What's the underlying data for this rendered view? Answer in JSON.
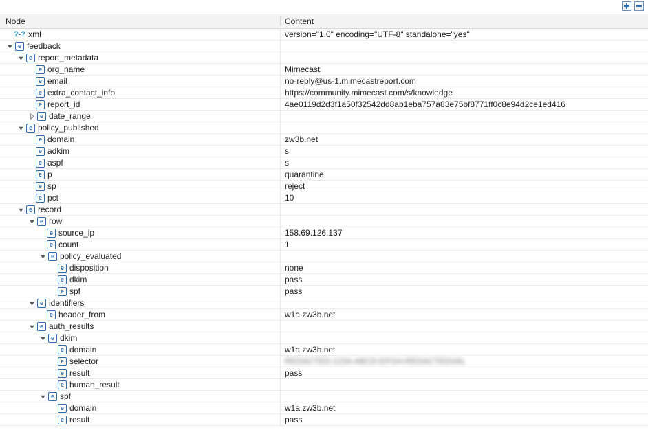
{
  "toolbar": {
    "expand_all": "Expand all",
    "collapse_all": "Collapse all"
  },
  "columns": {
    "node": "Node",
    "content": "Content"
  },
  "rows": [
    {
      "depth": 0,
      "toggle": "none",
      "icon": "pi",
      "label": "xml",
      "content": "version=\"1.0\" encoding=\"UTF-8\" standalone=\"yes\""
    },
    {
      "depth": 0,
      "toggle": "open",
      "icon": "e",
      "label": "feedback",
      "content": ""
    },
    {
      "depth": 1,
      "toggle": "open",
      "icon": "e",
      "label": "report_metadata",
      "content": ""
    },
    {
      "depth": 2,
      "toggle": "none",
      "icon": "e",
      "label": "org_name",
      "content": "Mimecast"
    },
    {
      "depth": 2,
      "toggle": "none",
      "icon": "e",
      "label": "email",
      "content": "no-reply@us-1.mimecastreport.com"
    },
    {
      "depth": 2,
      "toggle": "none",
      "icon": "e",
      "label": "extra_contact_info",
      "content": "https://community.mimecast.com/s/knowledge"
    },
    {
      "depth": 2,
      "toggle": "none",
      "icon": "e",
      "label": "report_id",
      "content": "4ae0119d2d3f1a50f32542dd8ab1eba757a83e75bf8771ff0c8e94d2ce1ed416"
    },
    {
      "depth": 2,
      "toggle": "closed",
      "icon": "e",
      "label": "date_range",
      "content": ""
    },
    {
      "depth": 1,
      "toggle": "open",
      "icon": "e",
      "label": "policy_published",
      "content": ""
    },
    {
      "depth": 2,
      "toggle": "none",
      "icon": "e",
      "label": "domain",
      "content": "zw3b.net"
    },
    {
      "depth": 2,
      "toggle": "none",
      "icon": "e",
      "label": "adkim",
      "content": "s"
    },
    {
      "depth": 2,
      "toggle": "none",
      "icon": "e",
      "label": "aspf",
      "content": "s"
    },
    {
      "depth": 2,
      "toggle": "none",
      "icon": "e",
      "label": "p",
      "content": "quarantine"
    },
    {
      "depth": 2,
      "toggle": "none",
      "icon": "e",
      "label": "sp",
      "content": "reject"
    },
    {
      "depth": 2,
      "toggle": "none",
      "icon": "e",
      "label": "pct",
      "content": "10"
    },
    {
      "depth": 1,
      "toggle": "open",
      "icon": "e",
      "label": "record",
      "content": ""
    },
    {
      "depth": 2,
      "toggle": "open",
      "icon": "e",
      "label": "row",
      "content": ""
    },
    {
      "depth": 3,
      "toggle": "none",
      "icon": "e",
      "label": "source_ip",
      "content": "158.69.126.137"
    },
    {
      "depth": 3,
      "toggle": "none",
      "icon": "e",
      "label": "count",
      "content": "1"
    },
    {
      "depth": 3,
      "toggle": "open",
      "icon": "e",
      "label": "policy_evaluated",
      "content": ""
    },
    {
      "depth": 4,
      "toggle": "none",
      "icon": "e",
      "label": "disposition",
      "content": "none"
    },
    {
      "depth": 4,
      "toggle": "none",
      "icon": "e",
      "label": "dkim",
      "content": "pass"
    },
    {
      "depth": 4,
      "toggle": "none",
      "icon": "e",
      "label": "spf",
      "content": "pass"
    },
    {
      "depth": 2,
      "toggle": "open",
      "icon": "e",
      "label": "identifiers",
      "content": ""
    },
    {
      "depth": 3,
      "toggle": "none",
      "icon": "e",
      "label": "header_from",
      "content": "w1a.zw3b.net"
    },
    {
      "depth": 2,
      "toggle": "open",
      "icon": "e",
      "label": "auth_results",
      "content": ""
    },
    {
      "depth": 3,
      "toggle": "open",
      "icon": "e",
      "label": "dkim",
      "content": ""
    },
    {
      "depth": 4,
      "toggle": "none",
      "icon": "e",
      "label": "domain",
      "content": "w1a.zw3b.net"
    },
    {
      "depth": 4,
      "toggle": "none",
      "icon": "e",
      "label": "selector",
      "content": "REDACTED-1234-ABCD-EFGH-REDACTEDVAL",
      "blur": true
    },
    {
      "depth": 4,
      "toggle": "none",
      "icon": "e",
      "label": "result",
      "content": "pass"
    },
    {
      "depth": 4,
      "toggle": "none",
      "icon": "e",
      "label": "human_result",
      "content": ""
    },
    {
      "depth": 3,
      "toggle": "open",
      "icon": "e",
      "label": "spf",
      "content": ""
    },
    {
      "depth": 4,
      "toggle": "none",
      "icon": "e",
      "label": "domain",
      "content": "w1a.zw3b.net"
    },
    {
      "depth": 4,
      "toggle": "none",
      "icon": "e",
      "label": "result",
      "content": "pass"
    }
  ]
}
